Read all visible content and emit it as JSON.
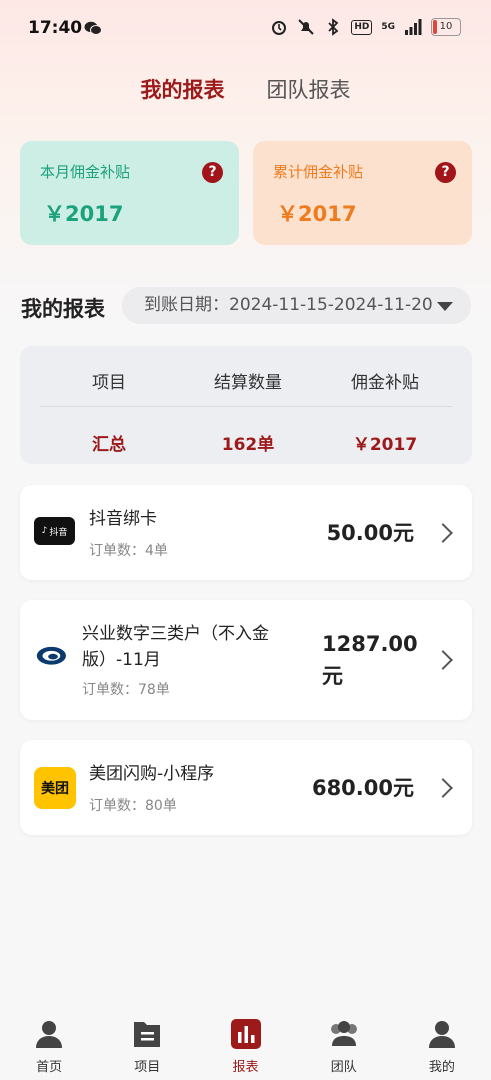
{
  "status_bar": {
    "time": "17:40",
    "hd": "HD",
    "signal": "5G",
    "battery": "10"
  },
  "tabs": [
    {
      "label": "我的报表",
      "active": true
    },
    {
      "label": "团队报表",
      "active": false
    }
  ],
  "cards": {
    "monthly": {
      "label": "本月佣金补贴",
      "value": "￥2017",
      "help": "?"
    },
    "total": {
      "label": "累计佣金补贴",
      "value": "￥2017",
      "help": "?"
    }
  },
  "report": {
    "title": "我的报表",
    "date_label": "到账日期：2024-11-15-2024-11-20"
  },
  "summary": {
    "headers": [
      "项目",
      "结算数量",
      "佣金补贴"
    ],
    "row": [
      "汇总",
      "162单",
      "￥2017"
    ]
  },
  "items": [
    {
      "name": "抖音绑卡",
      "sub": "订单数：4单",
      "amount": "50.00元",
      "logo": "抖音",
      "logo_text": "抖音"
    },
    {
      "name": "兴业数字三类户（不入金版）-11月",
      "sub": "订单数：78单",
      "amount": "1287.00元",
      "logo": "cib-logo"
    },
    {
      "name": "美团闪购-小程序",
      "sub": "订单数：80单",
      "amount": "680.00元",
      "logo": "美团",
      "logo_text": "美团"
    }
  ],
  "tabbar": [
    {
      "label": "首页",
      "icon": "user-icon"
    },
    {
      "label": "项目",
      "icon": "document-icon"
    },
    {
      "label": "报表",
      "icon": "bar-chart-icon",
      "active": true
    },
    {
      "label": "团队",
      "icon": "team-icon"
    },
    {
      "label": "我的",
      "icon": "profile-icon"
    }
  ],
  "colors": {
    "accent": "#9c1a1a",
    "green": "#1ba17b",
    "orange": "#ef7b1f"
  }
}
